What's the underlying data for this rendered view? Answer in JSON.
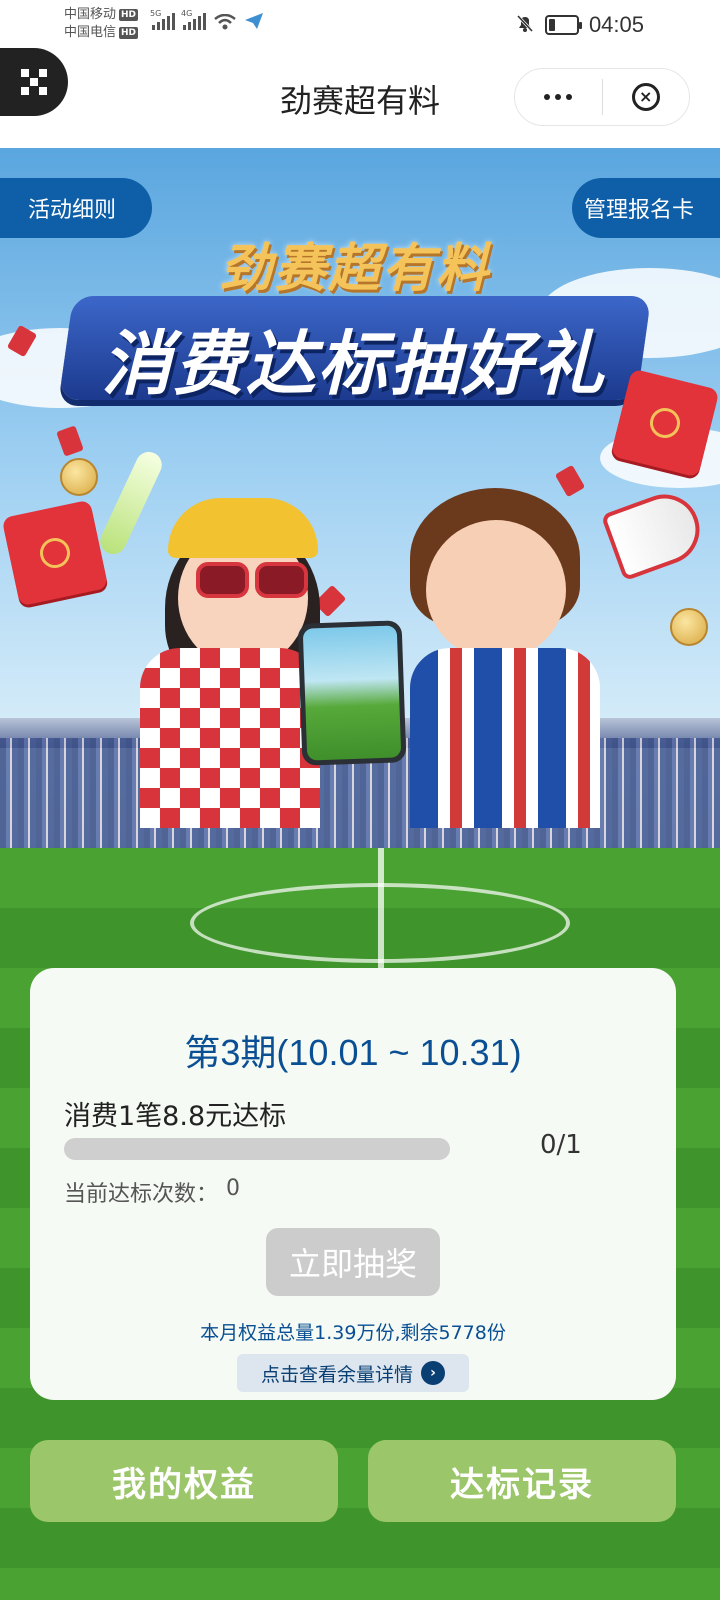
{
  "status_bar": {
    "carrier_1": "中国移动",
    "carrier_2": "中国电信",
    "hd_badge": "HD",
    "net_1": "5G",
    "net_2": "4G",
    "battery_level": 0.2,
    "time": "04:05"
  },
  "title_bar": {
    "title": "劲赛超有料"
  },
  "hero": {
    "rules_button": "活动细则",
    "manage_button": "管理报名卡",
    "headline_small": "劲赛超有料",
    "headline_big": "消费达标抽好礼"
  },
  "card": {
    "period": "第3期(10.01 ~ 10.31)",
    "task": "消费1笔8.8元达标",
    "progress": 0,
    "progress_count": "0/1",
    "count_label": "当前达标次数：",
    "count_value": "0",
    "draw_button": "立即抽奖",
    "quota_text": "本月权益总量1.39万份,剩余5778份",
    "detail_button": "点击查看余量详情"
  },
  "bottom": {
    "my_benefits": "我的权益",
    "records": "达标记录"
  },
  "colors": {
    "primary_blue": "#0a4f93",
    "button_green": "#9cc66a",
    "disabled_gray": "#cccccc"
  }
}
